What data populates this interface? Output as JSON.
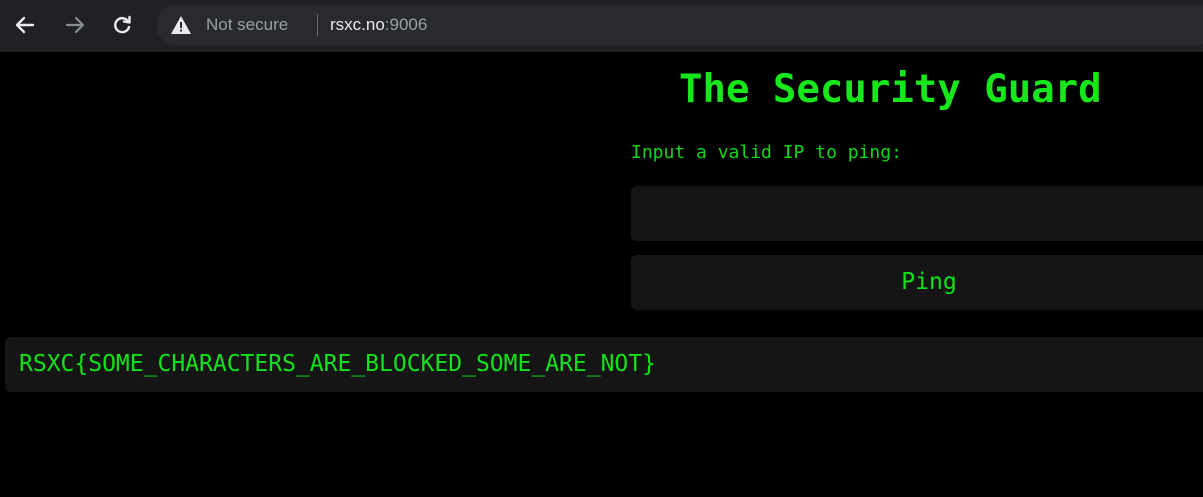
{
  "browser": {
    "back_icon": "arrow-left-icon",
    "forward_icon": "arrow-right-icon",
    "reload_icon": "reload-icon",
    "security_icon": "warning-triangle-icon",
    "security_label": "Not secure",
    "url_host": "rsxc.no",
    "url_port": ":9006"
  },
  "page": {
    "title": "The Security Guard",
    "ip_label": "Input a valid IP to ping:",
    "ip_input_value": "",
    "ping_button_label": "Ping",
    "result_text": "RSXC{SOME_CHARACTERS_ARE_BLOCKED_SOME_ARE_NOT}"
  },
  "colors": {
    "background": "#000000",
    "text_green": "#12e21a",
    "panel": "#151515",
    "chrome_bar": "#202124"
  }
}
